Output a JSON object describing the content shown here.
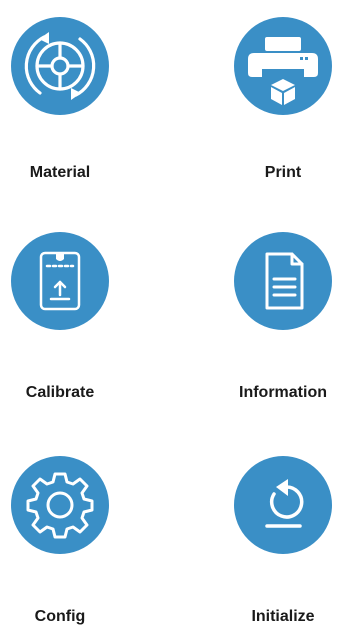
{
  "menu": {
    "items": [
      {
        "label": "Material",
        "icon": "material-reel-icon"
      },
      {
        "label": "Print",
        "icon": "printer-icon"
      },
      {
        "label": "Calibrate",
        "icon": "calibrate-icon"
      },
      {
        "label": "Information",
        "icon": "document-icon"
      },
      {
        "label": "Config",
        "icon": "gear-icon"
      },
      {
        "label": "Initialize",
        "icon": "reset-icon"
      }
    ]
  },
  "colors": {
    "icon_bg": "#3a8fc6",
    "icon_fg": "#ffffff",
    "label": "#1a1a1a"
  }
}
